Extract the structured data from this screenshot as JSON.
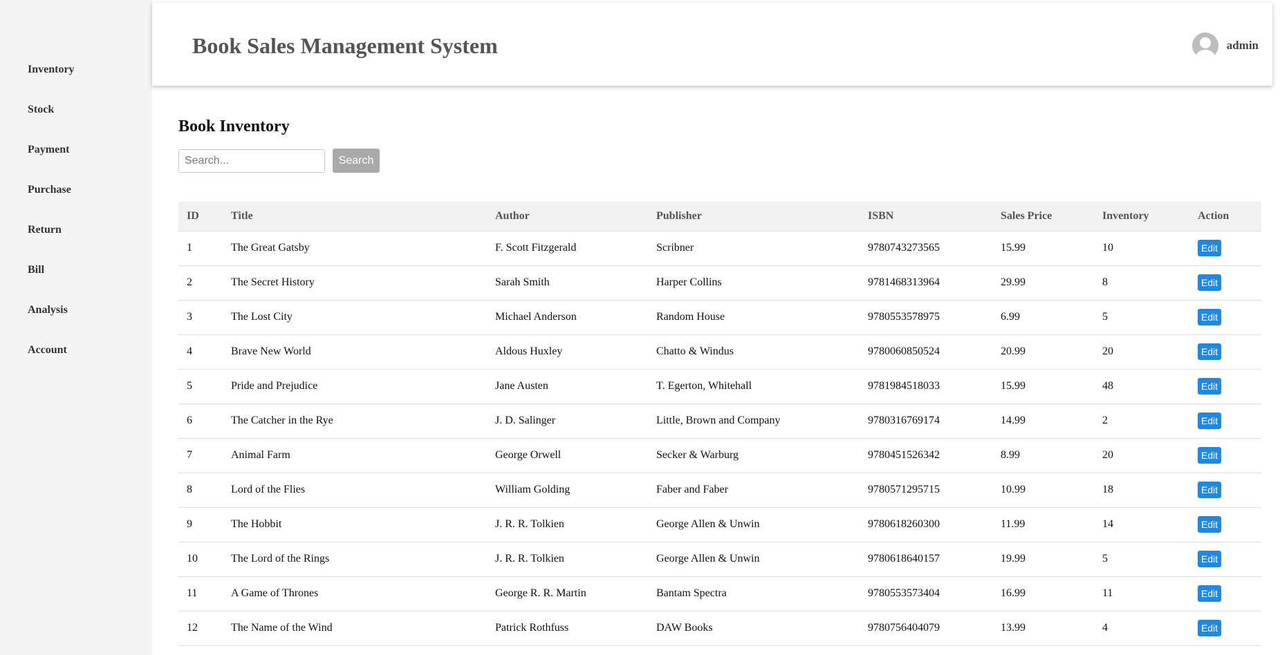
{
  "sidebar": {
    "items": [
      {
        "label": "Inventory"
      },
      {
        "label": "Stock"
      },
      {
        "label": "Payment"
      },
      {
        "label": "Purchase"
      },
      {
        "label": "Return"
      },
      {
        "label": "Bill"
      },
      {
        "label": "Analysis"
      },
      {
        "label": "Account"
      }
    ]
  },
  "header": {
    "title": "Book Sales Management System",
    "user": {
      "name": "admin",
      "avatar_icon": "user-avatar-icon"
    }
  },
  "main": {
    "title": "Book Inventory",
    "search": {
      "placeholder": "Search...",
      "value": "",
      "button_label": "Search"
    },
    "table": {
      "columns": [
        "ID",
        "Title",
        "Author",
        "Publisher",
        "ISBN",
        "Sales Price",
        "Inventory",
        "Action"
      ],
      "rows": [
        {
          "id": "1",
          "title": "The Great Gatsby",
          "author": "F. Scott Fitzgerald",
          "publisher": "Scribner",
          "isbn": "9780743273565",
          "price": "15.99",
          "inventory": "10",
          "action": "Edit"
        },
        {
          "id": "2",
          "title": "The Secret History",
          "author": "Sarah Smith",
          "publisher": "Harper Collins",
          "isbn": "9781468313964",
          "price": "29.99",
          "inventory": "8",
          "action": "Edit"
        },
        {
          "id": "3",
          "title": "The Lost City",
          "author": "Michael Anderson",
          "publisher": "Random House",
          "isbn": "9780553578975",
          "price": "6.99",
          "inventory": "5",
          "action": "Edit"
        },
        {
          "id": "4",
          "title": "Brave New World",
          "author": "Aldous Huxley",
          "publisher": "Chatto & Windus",
          "isbn": "9780060850524",
          "price": "20.99",
          "inventory": "20",
          "action": "Edit"
        },
        {
          "id": "5",
          "title": "Pride and Prejudice",
          "author": "Jane Austen",
          "publisher": "T. Egerton, Whitehall",
          "isbn": "9781984518033",
          "price": "15.99",
          "inventory": "48",
          "action": "Edit"
        },
        {
          "id": "6",
          "title": "The Catcher in the Rye",
          "author": "J. D. Salinger",
          "publisher": "Little, Brown and Company",
          "isbn": "9780316769174",
          "price": "14.99",
          "inventory": "2",
          "action": "Edit"
        },
        {
          "id": "7",
          "title": "Animal Farm",
          "author": "George Orwell",
          "publisher": "Secker & Warburg",
          "isbn": "9780451526342",
          "price": "8.99",
          "inventory": "20",
          "action": "Edit"
        },
        {
          "id": "8",
          "title": "Lord of the Flies",
          "author": "William Golding",
          "publisher": "Faber and Faber",
          "isbn": "9780571295715",
          "price": "10.99",
          "inventory": "18",
          "action": "Edit"
        },
        {
          "id": "9",
          "title": "The Hobbit",
          "author": "J. R. R. Tolkien",
          "publisher": "George Allen & Unwin",
          "isbn": "9780618260300",
          "price": "11.99",
          "inventory": "14",
          "action": "Edit"
        },
        {
          "id": "10",
          "title": "The Lord of the Rings",
          "author": "J. R. R. Tolkien",
          "publisher": "George Allen & Unwin",
          "isbn": "9780618640157",
          "price": "19.99",
          "inventory": "5",
          "action": "Edit"
        },
        {
          "id": "11",
          "title": "A Game of Thrones",
          "author": "George R. R. Martin",
          "publisher": "Bantam Spectra",
          "isbn": "9780553573404",
          "price": "16.99",
          "inventory": "11",
          "action": "Edit"
        },
        {
          "id": "12",
          "title": "The Name of the Wind",
          "author": "Patrick Rothfuss",
          "publisher": "DAW Books",
          "isbn": "9780756404079",
          "price": "13.99",
          "inventory": "4",
          "action": "Edit"
        }
      ]
    }
  },
  "colors": {
    "sidebar_bg": "#f4f4f4",
    "edit_button": "#1e88e5",
    "search_button": "#a9a9a9",
    "table_header_bg": "#f2f2f2"
  }
}
